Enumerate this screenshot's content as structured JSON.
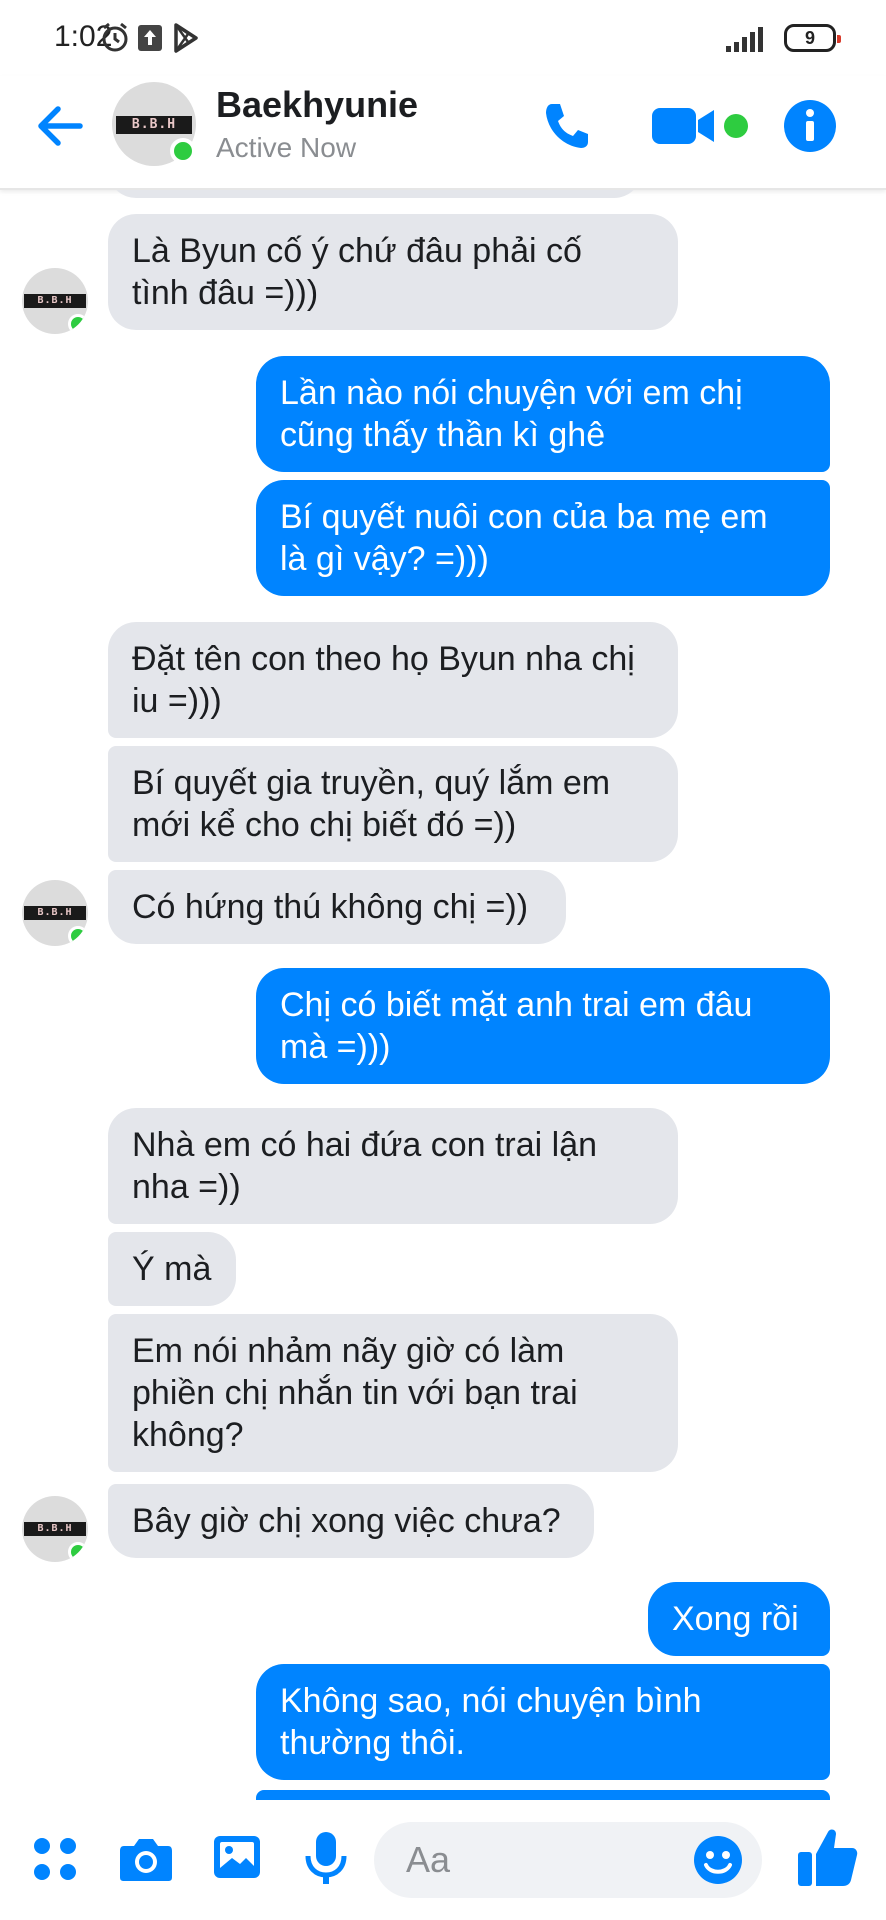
{
  "status_bar": {
    "time": "1:02",
    "battery": "9"
  },
  "header": {
    "contact_name": "Baekhyunie",
    "contact_status": "Active Now",
    "avatar_text": "B.B.H",
    "accent_color": "#0084ff",
    "online_color": "#2ecc40",
    "icons": [
      "back-arrow-icon",
      "phone-icon",
      "video-camera-icon",
      "info-icon"
    ]
  },
  "messages": [
    {
      "from": "them",
      "text": "Là Byun cố ý chứ đâu phải cố\ntình đâu =)))"
    },
    {
      "from": "me",
      "text": "Lần nào nói chuyện với em chị\ncũng thấy thần kì ghê"
    },
    {
      "from": "me",
      "text": "Bí quyết nuôi con của ba mẹ em\nlà gì vậy? =)))"
    },
    {
      "from": "them",
      "text": "Đặt tên con theo họ Byun nha chị\niu =)))"
    },
    {
      "from": "them",
      "text": "Bí quyết gia truyền, quý lắm em\nmới kể cho chị biết đó =))"
    },
    {
      "from": "them",
      "text": "Có hứng thú không chị =))"
    },
    {
      "from": "me",
      "text": "Chị có biết mặt anh trai em đâu\nmà =)))"
    },
    {
      "from": "them",
      "text": "Nhà em có hai đứa con trai lận\nnha =))"
    },
    {
      "from": "them",
      "text": "Ý mà"
    },
    {
      "from": "them",
      "text": "Em nói nhảm nãy giờ có làm\nphiền chị nhắn tin với bạn trai\nkhông?"
    },
    {
      "from": "them",
      "text": "Bây giờ chị xong việc chưa?"
    },
    {
      "from": "me",
      "text": "Xong rồi"
    },
    {
      "from": "me",
      "text": "Không sao, nói chuyện bình\nthường thôi."
    }
  ],
  "composer": {
    "placeholder": "Aa",
    "icons": [
      "menu-dots-icon",
      "camera-icon",
      "gallery-icon",
      "microphone-icon",
      "emoji-icon",
      "thumbs-up-icon"
    ]
  }
}
